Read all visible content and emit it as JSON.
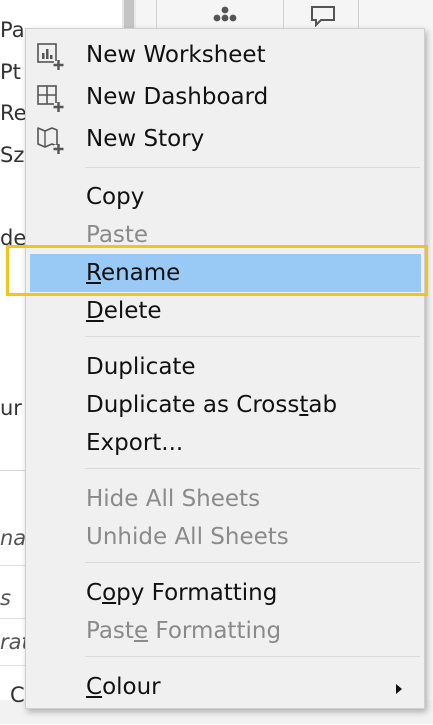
{
  "background": {
    "left_fragments": [
      "Pa",
      "Pt (",
      "Reg",
      "Sz",
      "de",
      "ur"
    ],
    "left_italic_fragments": [
      "nat",
      "s",
      "rat"
    ],
    "bottom_label": "C"
  },
  "menu": {
    "groups": [
      [
        {
          "id": "new-worksheet",
          "label": "New Worksheet",
          "icon": "new-worksheet-icon",
          "enabled": true
        },
        {
          "id": "new-dashboard",
          "label": "New Dashboard",
          "icon": "new-dashboard-icon",
          "enabled": true
        },
        {
          "id": "new-story",
          "label": "New Story",
          "icon": "new-story-icon",
          "enabled": true
        }
      ],
      [
        {
          "id": "copy",
          "label": "Copy",
          "enabled": true
        },
        {
          "id": "paste",
          "label": "Paste",
          "enabled": false
        },
        {
          "id": "rename",
          "label_parts": [
            "",
            "R",
            "ename"
          ],
          "enabled": true,
          "highlighted": true
        },
        {
          "id": "delete",
          "label_parts": [
            "",
            "D",
            "elete"
          ],
          "enabled": true
        }
      ],
      [
        {
          "id": "duplicate",
          "label": "Duplicate",
          "enabled": true
        },
        {
          "id": "duplicate-as-crosstab",
          "label_parts": [
            "Duplicate as Cross",
            "t",
            "ab"
          ],
          "enabled": true
        },
        {
          "id": "export",
          "label": "Export...",
          "enabled": true
        }
      ],
      [
        {
          "id": "hide-all-sheets",
          "label": "Hide All Sheets",
          "enabled": false
        },
        {
          "id": "unhide-all-sheets",
          "label": "Unhide All Sheets",
          "enabled": false
        }
      ],
      [
        {
          "id": "copy-formatting",
          "label_parts": [
            "C",
            "o",
            "py Formatting"
          ],
          "enabled": true
        },
        {
          "id": "paste-formatting",
          "label_parts": [
            "Past",
            "e",
            " Formatting"
          ],
          "enabled": false
        }
      ],
      [
        {
          "id": "colour",
          "label_parts": [
            "",
            "C",
            "olour"
          ],
          "enabled": true,
          "submenu": true
        }
      ]
    ]
  },
  "colors": {
    "menu_background": "#f0f0f0",
    "highlight": "#99c9f5",
    "annotation": "#f2c51e",
    "disabled_text": "#8a8a8a"
  }
}
